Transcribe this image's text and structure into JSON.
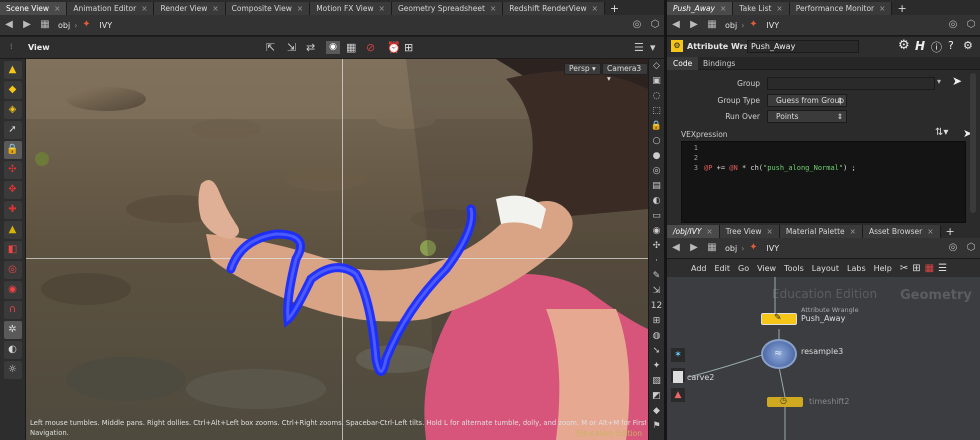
{
  "left_tabs": [
    "Scene View",
    "Animation Editor",
    "Render View",
    "Composite View",
    "Motion FX View",
    "Geometry Spreadsheet",
    "Redshift RenderView"
  ],
  "right_top_tabs": [
    "Push_Away",
    "Take List",
    "Performance Monitor"
  ],
  "right_bottom_tabs": [
    "/obj/IVY",
    "Tree View",
    "Material Palette",
    "Asset Browser"
  ],
  "path": {
    "obj": "obj",
    "node": "IVY"
  },
  "viewport": {
    "title": "View",
    "persp_label": "Persp",
    "camera_label": "Camera3",
    "help_line1": "Left mouse tumbles. Middle pans. Right dollies. Ctrl+Alt+Left box zooms. Ctrl+Right zooms. Spacebar-Ctrl-Left tilts. Hold L for alternate tumble, dolly, and zoom.    M or Alt+M for First Person",
    "help_line2": "Navigation.",
    "watermark": "Education Edition"
  },
  "param": {
    "type_label": "Attribute Wrangle",
    "node_name": "Push_Away",
    "sub_tabs": [
      "Code",
      "Bindings"
    ],
    "rows": [
      {
        "label": "Group",
        "value": ""
      },
      {
        "label": "Group Type",
        "value": "Guess from Group"
      },
      {
        "label": "Run Over",
        "value": "Points"
      }
    ],
    "vex_label": "VEXpression",
    "code_lines": [
      "@P += @N * ch(\"push_along_Normal\") ;",
      "",
      ""
    ],
    "line_numbers": [
      "1",
      "2",
      "3"
    ]
  },
  "network": {
    "menu": [
      "Add",
      "Edit",
      "Go",
      "View",
      "Tools",
      "Layout",
      "Labs",
      "Help"
    ],
    "watermark_edu": "Education Edition",
    "watermark_geo": "Geometry",
    "nodes": [
      {
        "type": "Attribute Wrangle",
        "name": "Push_Away"
      },
      {
        "type": "",
        "name": "resample3"
      },
      {
        "type": "",
        "name": "carve2"
      },
      {
        "type": "",
        "name": "timeshift2"
      }
    ]
  },
  "colors": {
    "accent": "#f5c518",
    "curve": "#1a2cff",
    "panel": "#2b2b2b"
  }
}
